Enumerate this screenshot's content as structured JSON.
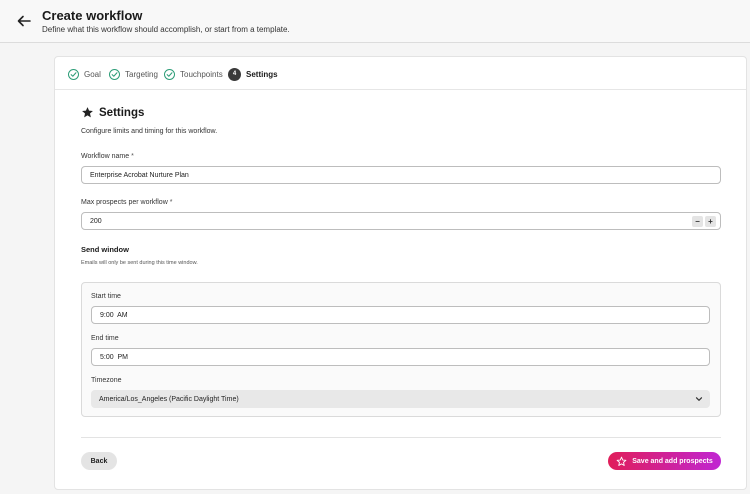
{
  "header": {
    "title": "Create workflow",
    "subtitle": "Define what this workflow should accomplish, or start from a template."
  },
  "steps": [
    {
      "label": "Goal",
      "state": "done"
    },
    {
      "label": "Targeting",
      "state": "done"
    },
    {
      "label": "Touchpoints",
      "state": "done"
    },
    {
      "label": "Settings",
      "state": "active",
      "number": "4"
    }
  ],
  "settings": {
    "title": "Settings",
    "description": "Configure limits and timing for this workflow.",
    "workflow_name_label": "Workflow name",
    "workflow_name_value": "Enterprise Acrobat Nurture Plan",
    "max_prospects_label": "Max prospects per workflow",
    "max_prospects_value": "200",
    "required_marker": "*",
    "decrement_symbol": "−",
    "increment_symbol": "+"
  },
  "send_window": {
    "title": "Send window",
    "description": "Emails will only be sent during this time window.",
    "start_time_label": "Start time",
    "start_time_value": "9:00  AM",
    "end_time_label": "End time",
    "end_time_value": "5:00  PM",
    "timezone_label": "Timezone",
    "timezone_value": "America/Los_Angeles (Pacific Daylight Time)"
  },
  "footer": {
    "back_label": "Back",
    "save_label": "Save and add prospects"
  },
  "colors": {
    "accent_gradient_start": "#e01e5a",
    "accent_gradient_end": "#c026d3",
    "step_done": "#2d9d78"
  }
}
